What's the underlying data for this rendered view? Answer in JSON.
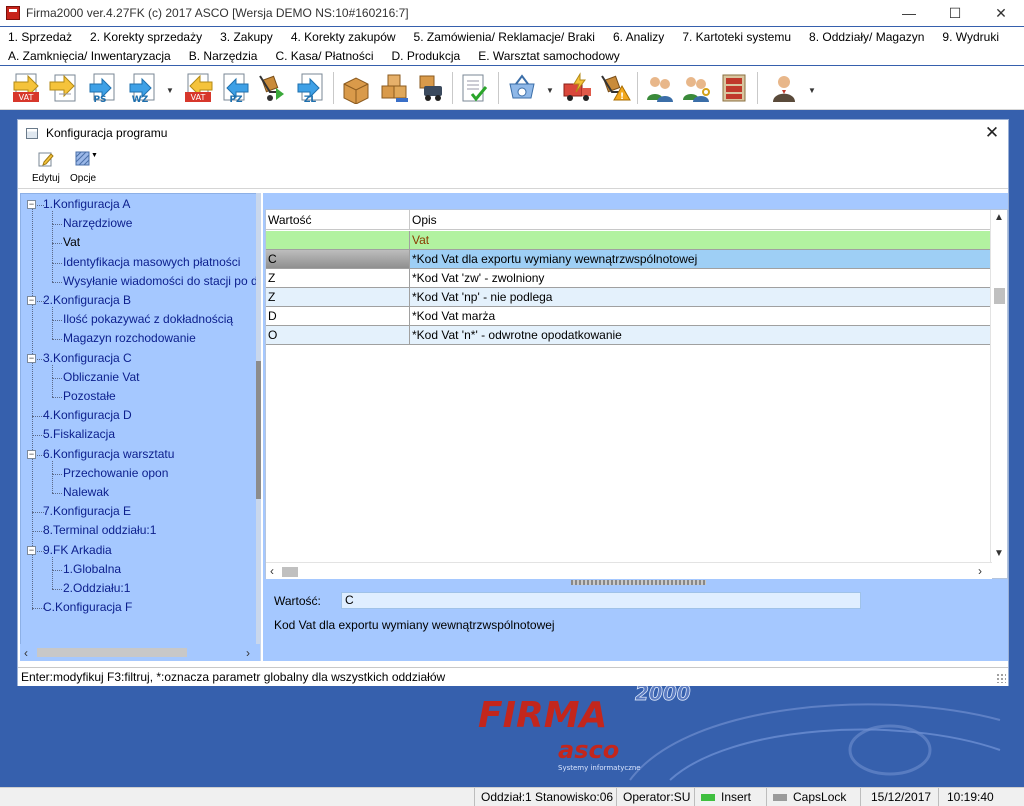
{
  "app": {
    "title": "Firma2000 ver.4.27FK  (c) 2017 ASCO  [Wersja DEMO NS:10#160216:7]",
    "win_minimize": "—",
    "win_maximize": "☐",
    "win_close": "✕"
  },
  "menu": {
    "row1": [
      "1. Sprzedaż",
      "2. Korekty sprzedaży",
      "3. Zakupy",
      "4. Korekty zakupów",
      "5. Zamówienia/ Reklamacje/ Braki",
      "6. Analizy",
      "7. Kartoteki systemu",
      "8. Oddziały/ Magazyn",
      "9. Wydruki"
    ],
    "row2": [
      "A. Zamknięcia/ Inwentaryzacja",
      "B. Narzędzia",
      "C. Kasa/ Płatności",
      "D. Produkcja",
      "E. Warsztat samochodowy"
    ]
  },
  "toolbar": {
    "icons": [
      "vat-invoice-icon",
      "document-icon",
      "ps-document-icon",
      "wz-document-icon",
      "vat-purchase-icon",
      "pz-document-icon",
      "cart-return-icon",
      "zl-document-icon",
      "box-icon",
      "boxes-stack-icon",
      "delivery-boxes-icon",
      "checklist-icon",
      "basket-icon",
      "truck-lightning-icon",
      "cart-warning-icon",
      "users-icon",
      "users-key-icon",
      "cabinet-icon",
      "operator-icon"
    ],
    "labels": {
      "vat": "VAT",
      "ps": "PS",
      "wz": "WZ",
      "vat2": "VAT",
      "pz": "PZ",
      "zl": "ZL"
    }
  },
  "background": {
    "logo_year": "2000",
    "logo_main": "FIRMA",
    "logo_brand": "asco",
    "logo_tagline": "Systemy informatyczne"
  },
  "dialog": {
    "title": "Konfiguracja programu",
    "close": "✕",
    "tools": [
      {
        "label": "Edytuj",
        "icon": "edit-icon"
      },
      {
        "label": "Opcje",
        "icon": "options-icon"
      }
    ],
    "tree": [
      {
        "label": "1.Konfiguracja A",
        "level": 0,
        "expander": "−"
      },
      {
        "label": "Narzędziowe",
        "level": 1
      },
      {
        "label": "Vat",
        "level": 1,
        "selected": true
      },
      {
        "label": "Identyfikacja masowych płatności",
        "level": 1
      },
      {
        "label": "Wysyłanie wiadomości do stacji po d",
        "level": 1
      },
      {
        "label": "2.Konfiguracja B",
        "level": 0,
        "expander": "−"
      },
      {
        "label": "Ilość pokazywać z dokładnością",
        "level": 1
      },
      {
        "label": "Magazyn rozchodowanie",
        "level": 1
      },
      {
        "label": "3.Konfiguracja C",
        "level": 0,
        "expander": "−"
      },
      {
        "label": "Obliczanie Vat",
        "level": 1
      },
      {
        "label": "Pozostałe",
        "level": 1
      },
      {
        "label": "4.Konfiguracja D",
        "level": 0
      },
      {
        "label": "5.Fiskalizacja",
        "level": 0
      },
      {
        "label": "6.Konfiguracja warsztatu",
        "level": 0,
        "expander": "−"
      },
      {
        "label": "Przechowanie opon",
        "level": 1
      },
      {
        "label": "Nalewak",
        "level": 1
      },
      {
        "label": "7.Konfiguracja E",
        "level": 0
      },
      {
        "label": "8.Terminal oddziału:1",
        "level": 0
      },
      {
        "label": "9.FK Arkadia",
        "level": 0,
        "expander": "−"
      },
      {
        "label": "1.Globalna",
        "level": 1
      },
      {
        "label": "2.Oddziału:1",
        "level": 1
      },
      {
        "label": "C.Konfiguracja F",
        "level": 0
      }
    ],
    "grid": {
      "columns": [
        "Wartość",
        "Opis"
      ],
      "rows": [
        {
          "value": "",
          "desc": "Vat",
          "bg": "#b2f2a0",
          "desc_color": "#8a3b00"
        },
        {
          "value": "C",
          "desc": "*Kod Vat dla exportu wymiany wewnątrzwspólnotowej",
          "bg": "#9ecff5",
          "value_bg": "#a8a8a8"
        },
        {
          "value": "Z",
          "desc": "*Kod Vat 'zw' - zwolniony",
          "bg": "#ffffff"
        },
        {
          "value": "Z",
          "desc": "*Kod Vat 'np' - nie podlega",
          "bg": "#e4f1fc"
        },
        {
          "value": "D",
          "desc": "*Kod Vat marża",
          "bg": "#ffffff"
        },
        {
          "value": "O",
          "desc": "*Kod Vat 'n*' - odwrotne opodatkowanie",
          "bg": "#e4f1fc"
        }
      ]
    },
    "detail": {
      "label": "Wartość:",
      "value": "C",
      "description": "Kod Vat dla exportu wymiany wewnątrzwspólnotowej"
    },
    "status": "Enter:modyfikuj  F3:filtruj,  *:oznacza parametr globalny dla wszystkich oddziałów"
  },
  "statusbar": {
    "station": "Oddział:1 Stanowisko:06",
    "operator": "Operator:SU",
    "insert": "Insert",
    "capslock": "CapsLock",
    "date": "15/12/2017",
    "time": "10:19:40",
    "insert_led": "#3fbf3f",
    "capslock_led": "#9a9a9a"
  }
}
